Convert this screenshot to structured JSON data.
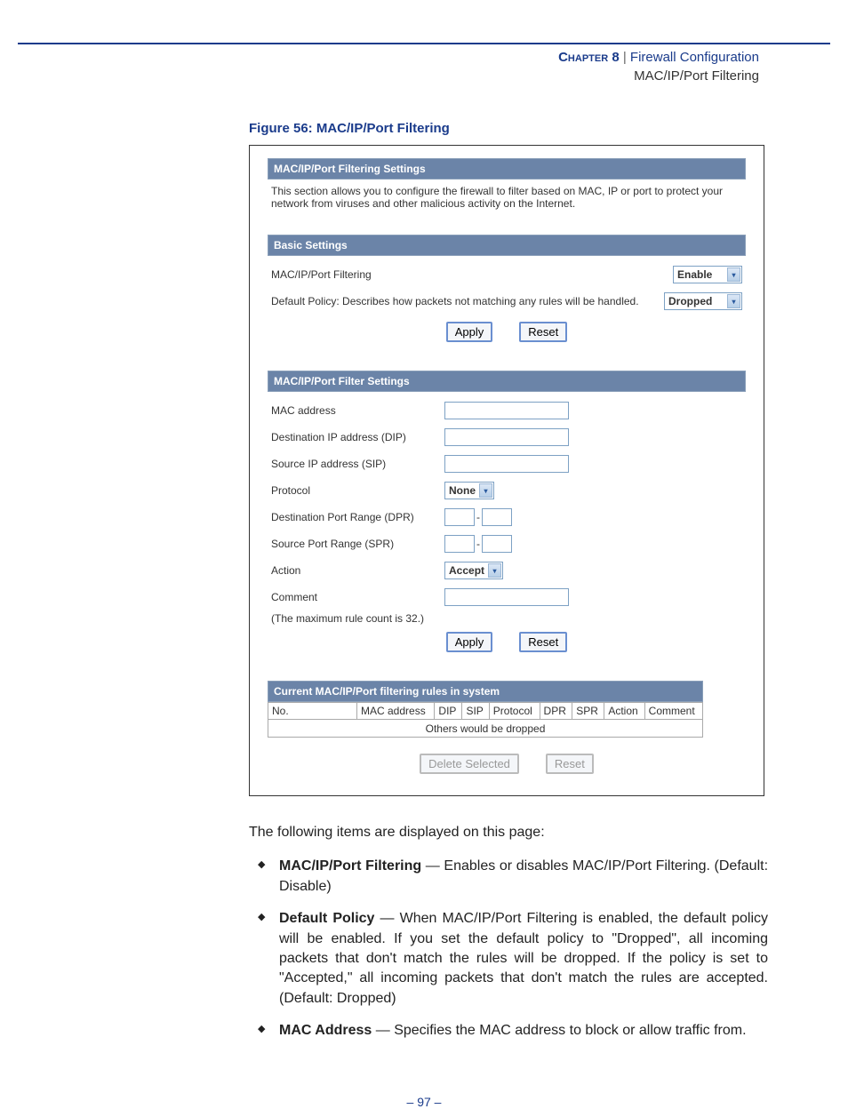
{
  "header": {
    "chapter": "Chapter 8",
    "sep": "|",
    "title": "Firewall Configuration",
    "subtitle": "MAC/IP/Port Filtering"
  },
  "figure_caption": "Figure 56:  MAC/IP/Port Filtering",
  "screenshot": {
    "panel1_title": "MAC/IP/Port Filtering Settings",
    "panel1_desc": "This section allows you to configure the firewall to filter based on MAC, IP or port to protect your network from viruses and other malicious activity on the Internet.",
    "basic_title": "Basic Settings",
    "row_filtering_label": "MAC/IP/Port Filtering",
    "row_filtering_value": "Enable",
    "row_policy_label": "Default Policy: Describes how packets not matching any rules will be handled.",
    "row_policy_value": "Dropped",
    "btn_apply": "Apply",
    "btn_reset": "Reset",
    "filter_title": "MAC/IP/Port Filter Settings",
    "f_mac": "MAC address",
    "f_dip": "Destination IP address (DIP)",
    "f_sip": "Source IP address (SIP)",
    "f_protocol": "Protocol",
    "f_protocol_value": "None",
    "f_dpr": "Destination Port Range (DPR)",
    "f_spr": "Source Port Range (SPR)",
    "f_action": "Action",
    "f_action_value": "Accept",
    "f_comment": "Comment",
    "max_note": "(The maximum rule count is 32.)",
    "rules_title": "Current MAC/IP/Port filtering rules in system",
    "th_no": "No.",
    "th_mac": "MAC address",
    "th_dip": "DIP",
    "th_sip": "SIP",
    "th_protocol": "Protocol",
    "th_dpr": "DPR",
    "th_spr": "SPR",
    "th_action": "Action",
    "th_comment": "Comment",
    "others_text": "Others would be dropped",
    "btn_delete": "Delete Selected",
    "dash": "-"
  },
  "body": {
    "intro": "The following items are displayed on this page:",
    "items": [
      {
        "term": "MAC/IP/Port Filtering",
        "desc": " — Enables or disables MAC/IP/Port Filtering. (Default: Disable)"
      },
      {
        "term": "Default Policy",
        "desc": " — When MAC/IP/Port Filtering is enabled, the default policy will be enabled. If you set the default policy to \"Dropped\", all incoming packets that don't match the rules will be dropped. If the policy is set to \"Accepted,\" all incoming packets that don't match the rules are accepted. (Default: Dropped)"
      },
      {
        "term": "MAC Address",
        "desc": " — Specifies the MAC address to block or allow traffic from."
      }
    ]
  },
  "page_number": "– 97 –"
}
